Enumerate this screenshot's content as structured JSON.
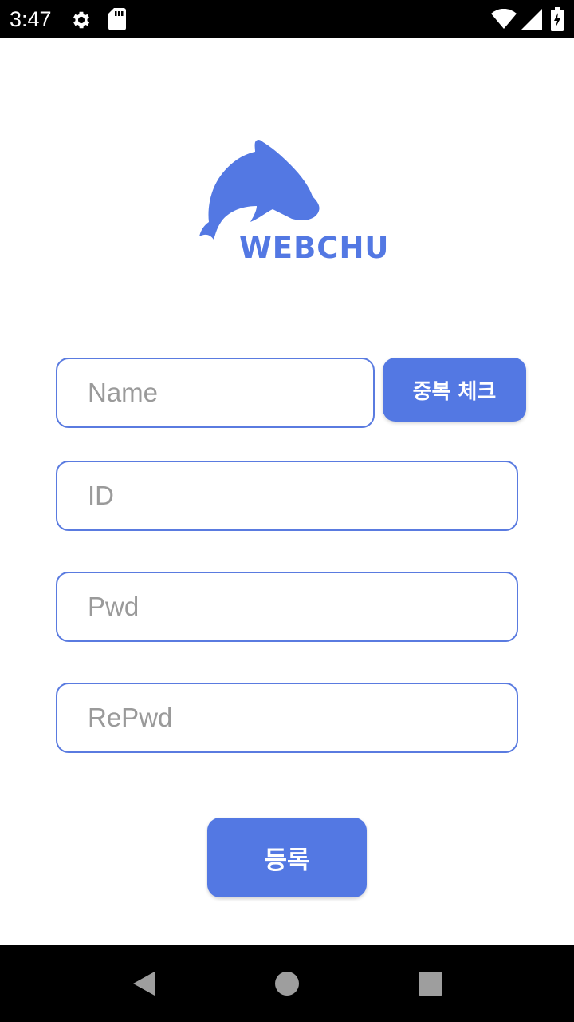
{
  "status_bar": {
    "time": "3:47",
    "icons": [
      "gear-icon",
      "sd-card-icon",
      "wifi-icon",
      "signal-icon",
      "battery-icon"
    ]
  },
  "logo": {
    "text": "WEBCHU",
    "icon": "dolphin-icon",
    "color": "#5378e3"
  },
  "form": {
    "name": {
      "placeholder": "Name",
      "value": ""
    },
    "duplicate_check_label": "중복 체크",
    "id": {
      "placeholder": "ID",
      "value": ""
    },
    "pwd": {
      "placeholder": "Pwd",
      "value": ""
    },
    "repwd": {
      "placeholder": "RePwd",
      "value": ""
    },
    "register_label": "등록"
  },
  "nav_bar": {
    "icons": [
      "back-icon",
      "home-icon",
      "recents-icon"
    ]
  },
  "colors": {
    "accent": "#5378e3",
    "field_border": "#5a7be0",
    "placeholder": "#9a9a9a"
  }
}
